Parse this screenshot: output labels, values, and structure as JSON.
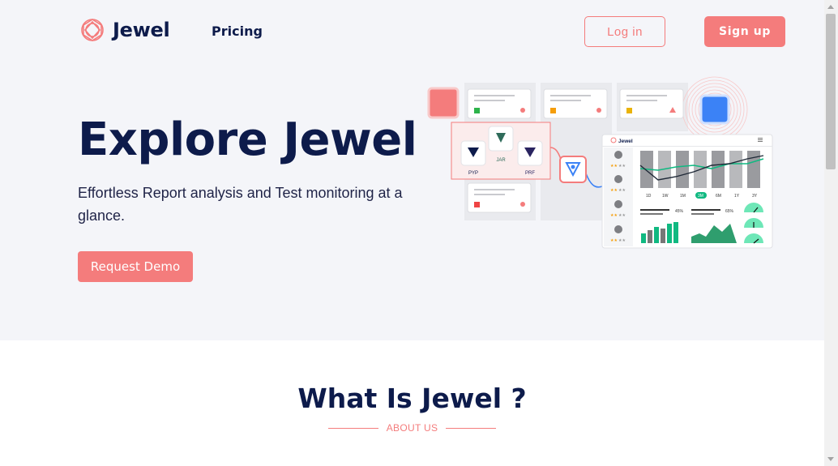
{
  "brand": {
    "name": "Jewel",
    "accent": "#f47c7c",
    "navy": "#0d1b4b"
  },
  "nav": {
    "pricing": "Pricing",
    "login": "Log in",
    "signup": "Sign up"
  },
  "hero": {
    "title": "Explore Jewel",
    "subtitle": "Effortless Report analysis and Test monitoring at a glance.",
    "cta": "Request Demo"
  },
  "illustration": {
    "file_labels": [
      "PYP",
      "JAR",
      "PRF"
    ],
    "dashboard_brand": "Jewel",
    "time_ranges": [
      "1D",
      "1W",
      "1M",
      "3M",
      "6M",
      "1Y",
      "3Y"
    ],
    "active_range": "3M",
    "stats": [
      "45%",
      "65%"
    ]
  },
  "about": {
    "title": "What Is Jewel ?",
    "kicker": "ABOUT US"
  }
}
